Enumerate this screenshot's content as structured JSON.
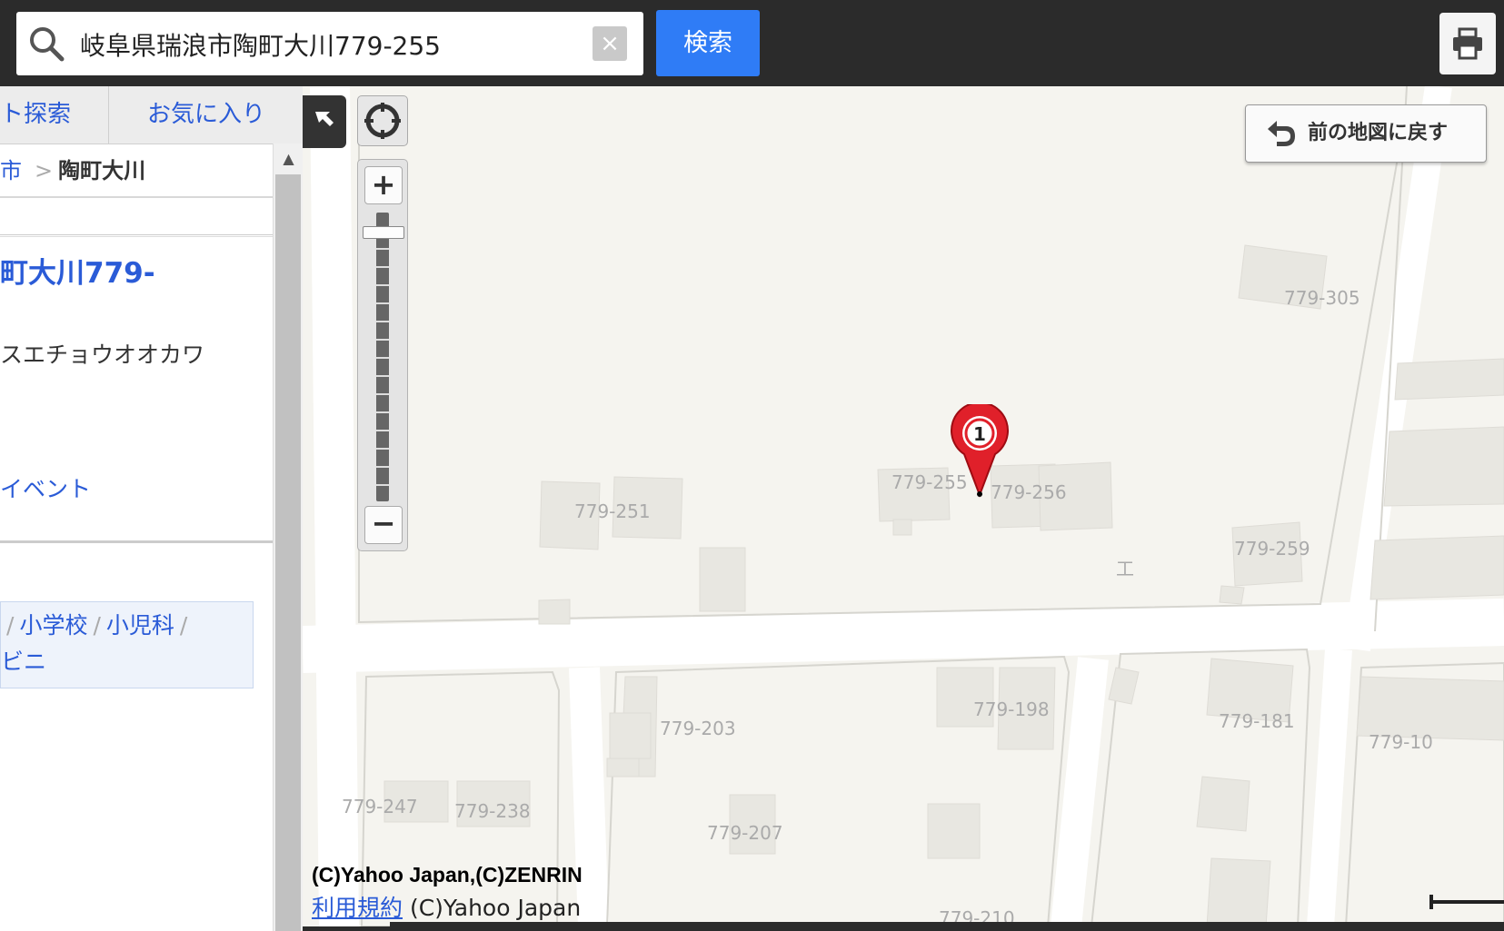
{
  "search": {
    "value": "岐阜県瑞浪市陶町大川779-255",
    "clear_label": "×",
    "button_label": "検索"
  },
  "sidebar": {
    "tabs": [
      {
        "label": "ト探索"
      },
      {
        "label": "お気に入り"
      }
    ],
    "breadcrumb": {
      "city": "市",
      "separator": ">",
      "current": "陶町大川"
    },
    "scroll_up": "▲",
    "result": {
      "title": "町大川779-",
      "kana": "スエチョウオオカワ",
      "event_link": "イベント"
    },
    "tags": {
      "line1": [
        "小学校",
        "小児科"
      ],
      "line2": "ビニ"
    }
  },
  "map": {
    "back_button_label": "前の地図に戻す",
    "marker_number": "1",
    "zoom_in_label": "+",
    "zoom_out_label": "−",
    "zoom_level_fraction": 0.05,
    "lot_labels": [
      "779-305",
      "779-255",
      "779-256",
      "779-251",
      "779-259",
      "779-203",
      "779-198",
      "779-181",
      "779-10",
      "779-247",
      "779-238",
      "779-207",
      "779-210"
    ],
    "building_symbol": "工",
    "credit": "(C)Yahoo Japan,(C)ZENRIN",
    "terms_link": "利用規約",
    "terms_suffix": " (C)Yahoo Japan"
  },
  "colors": {
    "topbar": "#2b2b2b",
    "search_button": "#2f7cf6",
    "link": "#2a5bd7",
    "map_background": "#f5f4ef",
    "marker": "#e0202a"
  },
  "icons": {
    "search": "search-icon",
    "print": "printer-icon",
    "collapse": "arrow-collapse-icon",
    "locate": "crosshair-icon",
    "back": "undo-arrow-icon",
    "marker": "map-pin-icon"
  }
}
